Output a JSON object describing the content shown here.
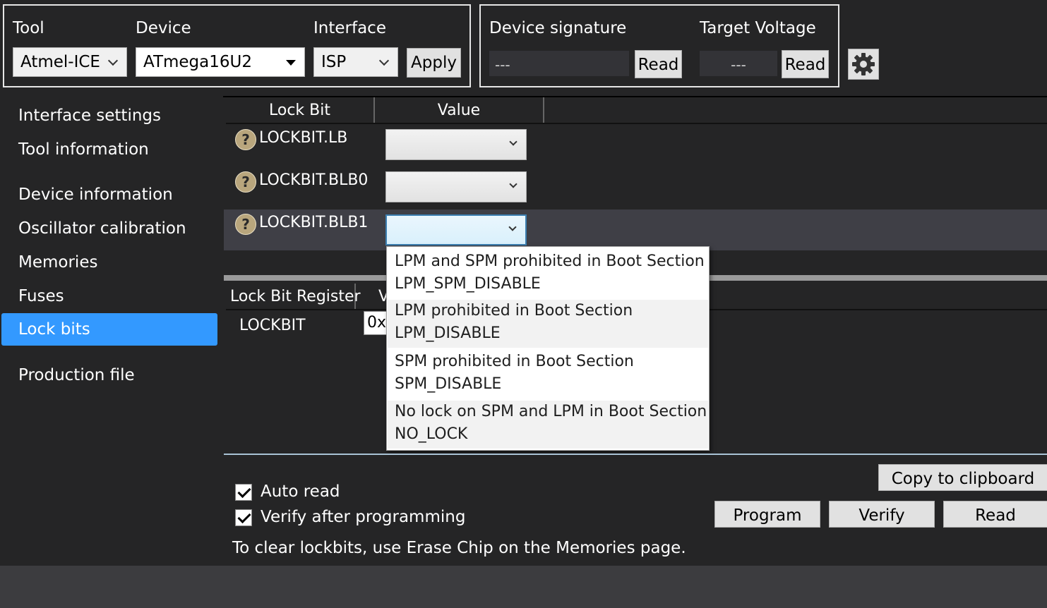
{
  "toolbar": {
    "tool_label": "Tool",
    "tool_value": "Atmel-ICE",
    "device_label": "Device",
    "device_value": "ATmega16U2",
    "interface_label": "Interface",
    "interface_value": "ISP",
    "apply_label": "Apply",
    "signature_label": "Device signature",
    "signature_value": "---",
    "signature_read_label": "Read",
    "voltage_label": "Target Voltage",
    "voltage_value": "---",
    "voltage_read_label": "Read",
    "settings_icon": "gear-icon"
  },
  "sidebar": {
    "items": [
      {
        "label": "Interface settings",
        "active": false
      },
      {
        "label": "Tool information",
        "active": false
      },
      {
        "label": "Device information",
        "active": false
      },
      {
        "label": "Oscillator calibration",
        "active": false
      },
      {
        "label": "Memories",
        "active": false
      },
      {
        "label": "Fuses",
        "active": false
      },
      {
        "label": "Lock bits",
        "active": true
      },
      {
        "label": "Production file",
        "active": false
      }
    ],
    "active_color": "#3399ff"
  },
  "lockbits": {
    "headers": {
      "bit": "Lock Bit",
      "value": "Value"
    },
    "rows": [
      {
        "name": "LOCKBIT.LB",
        "value": ""
      },
      {
        "name": "LOCKBIT.BLB0",
        "value": ""
      },
      {
        "name": "LOCKBIT.BLB1",
        "value": ""
      }
    ]
  },
  "dropdown": {
    "options": [
      {
        "text": "LPM and SPM prohibited in Boot Section",
        "value": "LPM_SPM_DISABLE"
      },
      {
        "text": "LPM prohibited in Boot Section",
        "value": "LPM_DISABLE"
      },
      {
        "text": "SPM prohibited in Boot Section",
        "value": "SPM_DISABLE"
      },
      {
        "text": "No lock on SPM and LPM in Boot Section",
        "value": "NO_LOCK"
      }
    ]
  },
  "register": {
    "header_name": "Lock Bit Register",
    "header_value": "V",
    "name": "LOCKBIT",
    "value": "0x"
  },
  "bottom": {
    "copy_label": "Copy to clipboard",
    "auto_read_label": "Auto read",
    "auto_read_checked": true,
    "verify_label": "Verify after programming",
    "verify_checked": true,
    "program_label": "Program",
    "verify_button_label": "Verify",
    "read_label": "Read",
    "note": "To clear lockbits, use Erase Chip on the Memories page."
  }
}
